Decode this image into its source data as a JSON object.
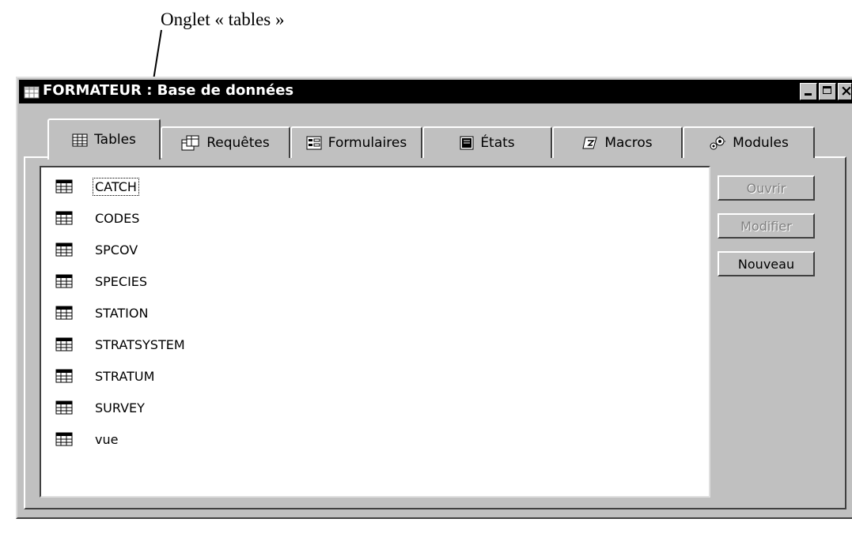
{
  "annotation": {
    "text": "Onglet « tables »"
  },
  "window": {
    "title": "FORMATEUR : Base de données",
    "controls": [
      "minimize",
      "maximize",
      "close"
    ]
  },
  "tabs": [
    {
      "label": "Tables",
      "icon": "table-icon",
      "active": true
    },
    {
      "label": "Requêtes",
      "icon": "query-icon",
      "active": false
    },
    {
      "label": "Formulaires",
      "icon": "form-icon",
      "active": false
    },
    {
      "label": "États",
      "icon": "report-icon",
      "active": false
    },
    {
      "label": "Macros",
      "icon": "macro-icon",
      "active": false
    },
    {
      "label": "Modules",
      "icon": "module-icon",
      "active": false
    }
  ],
  "tables": [
    {
      "name": "CATCH",
      "selected": true
    },
    {
      "name": "CODES"
    },
    {
      "name": "SPCOV"
    },
    {
      "name": "SPECIES"
    },
    {
      "name": "STATION"
    },
    {
      "name": "STRATSYSTEM"
    },
    {
      "name": "STRATUM"
    },
    {
      "name": "SURVEY"
    },
    {
      "name": "vue"
    }
  ],
  "buttons": {
    "open": {
      "label": "Ouvrir",
      "enabled": false
    },
    "modify": {
      "label": "Modifier",
      "enabled": false
    },
    "new": {
      "label": "Nouveau",
      "enabled": true
    }
  }
}
